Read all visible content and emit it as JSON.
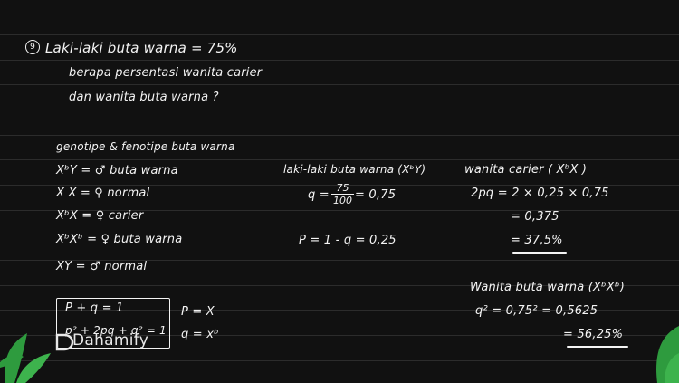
{
  "question": {
    "number": "9",
    "line1": "Laki-laki buta warna = 75%",
    "line2": "berapa persentasi wanita carier",
    "line3": "dan wanita buta warna ?"
  },
  "genotype": {
    "heading": "genotipe & fenotipe buta warna",
    "rows": [
      "XᵇY = ♂ buta warna",
      "X X = ♀ normal",
      "XᵇX = ♀ carier",
      "XᵇXᵇ = ♀ buta warna",
      "XY = ♂ normal"
    ]
  },
  "formula": {
    "line1": "P + q = 1",
    "line2": "p² + 2pq + q² = 1",
    "p_def": "P = X",
    "q_def": "q = xᵇ"
  },
  "male": {
    "heading": "laki-laki buta warna (XᵇY)",
    "q_prefix": "q =",
    "q_num": "75",
    "q_den": "100",
    "q_result": "= 0,75",
    "p_line": "P = 1 - q = 0,25"
  },
  "carrier": {
    "heading": "wanita carier ( XᵇX )",
    "line1": "2pq = 2 × 0,25 × 0,75",
    "line2": "= 0,375",
    "line3": "= 37,5%"
  },
  "colorblind": {
    "heading": "Wanita buta warna (XᵇXᵇ)",
    "line1": "q² = 0,75² = 0,5625",
    "line2": "= 56,25%"
  },
  "brand": {
    "name": "Dahamify"
  },
  "colors": {
    "background": "#111111",
    "ink": "#f4f4f4",
    "leaf": "#2e9b3e"
  }
}
